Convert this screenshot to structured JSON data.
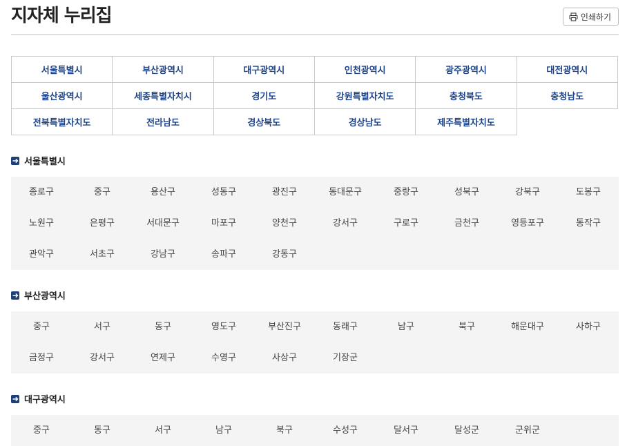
{
  "page": {
    "title": "지자체 누리집"
  },
  "toolbar": {
    "print_label": "인쇄하기",
    "print_icon": "printer-icon"
  },
  "regions": [
    [
      "서울특별시",
      "부산광역시",
      "대구광역시",
      "인천광역시",
      "광주광역시",
      "대전광역시"
    ],
    [
      "울산광역시",
      "세종특별자치시",
      "경기도",
      "강원특별자치도",
      "충청북도",
      "충청남도"
    ],
    [
      "전북특별자치도",
      "전라남도",
      "경상북도",
      "경상남도",
      "제주특별자치도",
      ""
    ]
  ],
  "sections": [
    {
      "title": "서울특별시",
      "districts": [
        [
          "종로구",
          "중구",
          "용산구",
          "성동구",
          "광진구",
          "동대문구",
          "중랑구",
          "성북구",
          "강북구",
          "도봉구"
        ],
        [
          "노원구",
          "은평구",
          "서대문구",
          "마포구",
          "양천구",
          "강서구",
          "구로구",
          "금천구",
          "영등포구",
          "동작구"
        ],
        [
          "관악구",
          "서초구",
          "강남구",
          "송파구",
          "강동구"
        ]
      ]
    },
    {
      "title": "부산광역시",
      "districts": [
        [
          "중구",
          "서구",
          "동구",
          "영도구",
          "부산진구",
          "동래구",
          "남구",
          "북구",
          "해운대구",
          "사하구"
        ],
        [
          "금정구",
          "강서구",
          "연제구",
          "수영구",
          "사상구",
          "기장군"
        ]
      ]
    },
    {
      "title": "대구광역시",
      "districts": [
        [
          "중구",
          "동구",
          "서구",
          "남구",
          "북구",
          "수성구",
          "달서구",
          "달성군",
          "군위군"
        ]
      ]
    }
  ],
  "colors": {
    "accent": "#1d4489",
    "section_icon": "#1d3f73",
    "box_bg": "#f4f4f4",
    "border": "#c9c9c9"
  }
}
